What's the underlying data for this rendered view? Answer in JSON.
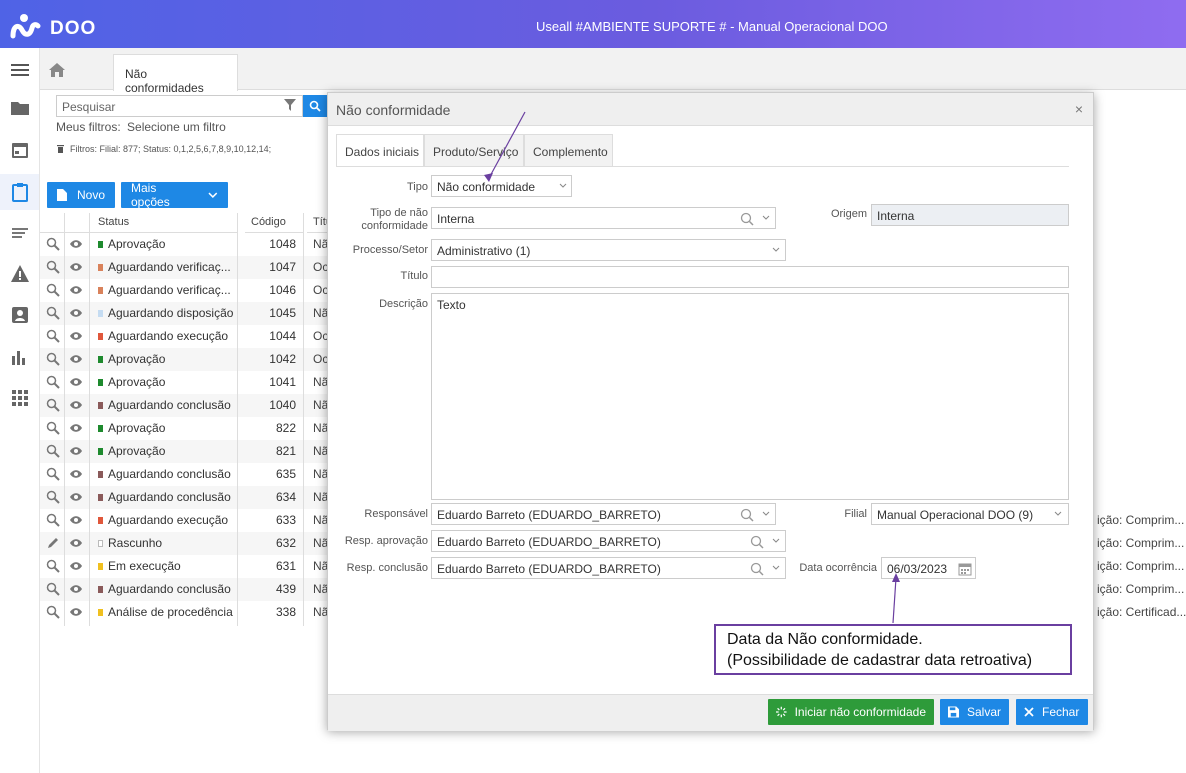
{
  "window": {
    "brand": "DOO",
    "title": "Useall #AMBIENTE SUPORTE # - Manual Operacional DOO"
  },
  "tabs": {
    "main_tab": "Não conformidades"
  },
  "list": {
    "search_placeholder": "Pesquisar",
    "my_filters_label": "Meus filtros:",
    "my_filters_value": "Selecione um filtro",
    "filter_text": "Filtros: Filial: 877; Status: 0,1,2,5,6,7,8,9,10,12,14;",
    "new_button": "Novo",
    "more_button": "Mais opções",
    "columns": [
      "Status",
      "Código",
      "Títu"
    ],
    "rows": [
      {
        "status": "Aprovação",
        "color": "#1e8a2e",
        "code": "1048",
        "title": "Nã"
      },
      {
        "status": "Aguardando verificaç...",
        "color": "#d9825b",
        "code": "1047",
        "title": "Oc"
      },
      {
        "status": "Aguardando verificaç...",
        "color": "#d9825b",
        "code": "1046",
        "title": "Oc"
      },
      {
        "status": "Aguardando disposição",
        "color": "#c5dcf2",
        "code": "1045",
        "title": "Nã"
      },
      {
        "status": "Aguardando execução",
        "color": "#e0573b",
        "code": "1044",
        "title": "Oc"
      },
      {
        "status": "Aprovação",
        "color": "#1e8a2e",
        "code": "1042",
        "title": "Oc"
      },
      {
        "status": "Aprovação",
        "color": "#1e8a2e",
        "code": "1041",
        "title": "Nã"
      },
      {
        "status": "Aguardando conclusão",
        "color": "#8a5a5a",
        "code": "1040",
        "title": "Nã"
      },
      {
        "status": "Aprovação",
        "color": "#1e8a2e",
        "code": "822",
        "title": "Nã"
      },
      {
        "status": "Aprovação",
        "color": "#1e8a2e",
        "code": "821",
        "title": "Nã"
      },
      {
        "status": "Aguardando conclusão",
        "color": "#8a5a5a",
        "code": "635",
        "title": "Nã"
      },
      {
        "status": "Aguardando conclusão",
        "color": "#8a5a5a",
        "code": "634",
        "title": "Nã"
      },
      {
        "status": "Aguardando execução",
        "color": "#e0573b",
        "code": "633",
        "title": "Nã"
      },
      {
        "status": "Rascunho",
        "color": "#ffffff",
        "code": "632",
        "title": "Nã"
      },
      {
        "status": "Em execução",
        "color": "#f0c020",
        "code": "631",
        "title": "Nã"
      },
      {
        "status": "Aguardando conclusão",
        "color": "#8a5a5a",
        "code": "439",
        "title": "Nã"
      },
      {
        "status": "Análise de procedência",
        "color": "#f0c020",
        "code": "338",
        "title": "Nã"
      }
    ],
    "right_texts": [
      "ição: Comprim...",
      "ição: Comprim...",
      "ição: Comprim...",
      "ição: Comprim...",
      "ição: Certificad..."
    ]
  },
  "modal": {
    "title": "Não conformidade",
    "tabs": [
      "Dados iniciais",
      "Produto/Serviço",
      "Complemento"
    ],
    "tipo_label": "Tipo",
    "tipo_value": "Não conformidade",
    "tipo_nc_label1": "Tipo de não",
    "tipo_nc_label2": "conformidade",
    "tipo_nc_value": "Interna",
    "origem_label": "Origem",
    "origem_value": "Interna",
    "processo_label": "Processo/Setor",
    "processo_value": "Administrativo (1)",
    "titulo_label": "Título",
    "titulo_value": "",
    "descricao_label": "Descrição",
    "descricao_value": "Texto",
    "responsavel_label": "Responsável",
    "responsavel_value": "Eduardo Barreto  (EDUARDO_BARRETO)",
    "filial_label": "Filial",
    "filial_value": "Manual Operacional DOO (9)",
    "resp_aprov_label": "Resp. aprovação",
    "resp_aprov_value": "Eduardo Barreto  (EDUARDO_BARRETO)",
    "resp_concl_label": "Resp. conclusão",
    "resp_concl_value": "Eduardo Barreto  (EDUARDO_BARRETO)",
    "data_label": "Data ocorrência",
    "data_value": "06/03/2023",
    "btn_iniciar": "Iniciar não conformidade",
    "btn_salvar": "Salvar",
    "btn_fechar": "Fechar"
  },
  "annotation": {
    "line1": "Data da Não conformidade.",
    "line2": "(Possibilidade de cadastrar data retroativa)"
  },
  "colors": {
    "accent": "#1e88e5",
    "success": "#2e9b3a",
    "annotation": "#6a3fa0"
  }
}
